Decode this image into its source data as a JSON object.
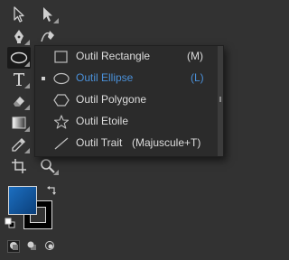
{
  "toolbar": {
    "tools": [
      {
        "name": "selection-tool-icon"
      },
      {
        "name": "direct-selection-tool-icon"
      },
      {
        "name": "pen-tool-icon"
      },
      {
        "name": "curvature-tool-icon"
      },
      {
        "name": "ellipse-tool-icon",
        "active": true
      },
      {
        "name": "type-tool-icon"
      },
      {
        "name": "eraser-tool-icon"
      },
      {
        "name": "rotate-tool-icon"
      },
      {
        "name": "gradient-tool-icon"
      },
      {
        "name": "eyedropper-tool-icon"
      },
      {
        "name": "artboard-tool-icon"
      },
      {
        "name": "zoom-tool-icon"
      }
    ],
    "fill_color_start": "#1c6fc1",
    "fill_color_end": "#0b3f7a",
    "stroke_color": "#000000"
  },
  "flyout": {
    "items": [
      {
        "label": "Outil Rectangle",
        "shortcut": "(M)",
        "icon": "rectangle-icon",
        "selected": false
      },
      {
        "label": "Outil Ellipse",
        "shortcut": "(L)",
        "icon": "ellipse-icon",
        "selected": true
      },
      {
        "label": "Outil Polygone",
        "shortcut": "",
        "icon": "polygon-icon",
        "selected": false
      },
      {
        "label": "Outil Etoile",
        "shortcut": "",
        "icon": "star-icon",
        "selected": false
      },
      {
        "label": "Outil Trait",
        "shortcut": "(Majuscule+T)",
        "icon": "line-icon",
        "selected": false
      }
    ]
  },
  "colors": {
    "selected_text": "#4a90d9",
    "menu_text": "#dcdcdc",
    "panel_bg": "#323232",
    "menu_bg": "#2b2b2b"
  }
}
